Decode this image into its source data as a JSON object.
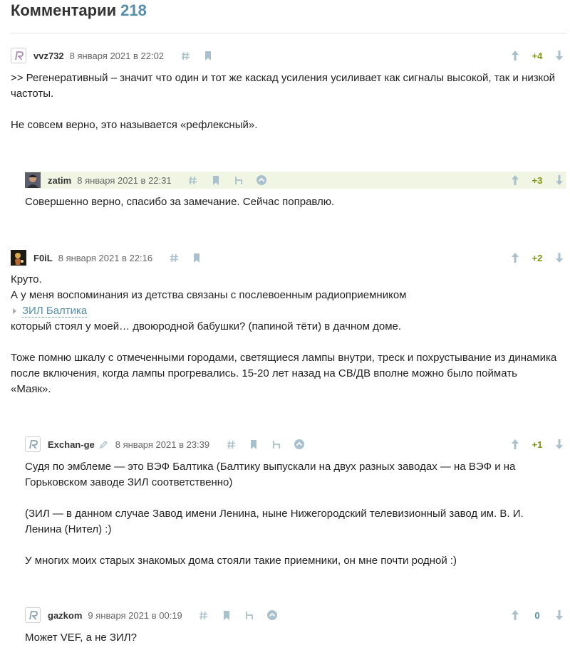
{
  "header": {
    "title": "Комментарии",
    "count": "218"
  },
  "comments": [
    {
      "user": "vvz732",
      "date": "8 января 2021 в 22:02",
      "score": "+4",
      "lines": [
        ">> Регенеративный – значит что один и тот же каскад усиления усиливает как сигналы высокой, так и низкой",
        "частоты.",
        "Не совсем верно, это называется «рефлексный»."
      ]
    },
    {
      "user": "zatim",
      "date": "8 января 2021 в 22:31",
      "score": "+3",
      "lines": [
        "Совершенно верно, спасибо за замечание. Сейчас поправлю."
      ]
    },
    {
      "user": "F0iL",
      "date": "8 января 2021 в 22:16",
      "score": "+2",
      "spoiler": "ЗИЛ Балтика",
      "lines": [
        "Круто.",
        "А у меня воспоминания из детства связаны с послевоенным радиоприемником",
        "который стоял у моей… двоюродной бабушки? (папиной тёти) в дачном доме.",
        "Тоже помню шкалу с отмеченными городами, светящиеся лампы внутри, треск и похрустывание из динамика",
        "после включения, когда лампы прогревались. 15-20 лет назад на СВ/ДВ вполне можно было поймать",
        "«Маяк»."
      ]
    },
    {
      "user": "Exchan-ge",
      "date": "8 января 2021 в 23:39",
      "score": "+1",
      "lines": [
        "Судя по эмблеме — это ВЭФ Балтика (Балтику выпускали на двух разных заводах — на ВЭФ и на",
        "Горьковском заводе ЗИЛ соответственно)",
        "(ЗИЛ — в данном случае Завод имени Ленина, ныне Нижегородский телевизионный завод им. В. И.",
        "Ленина (Нител) :)",
        "У многих моих старых знакомых дома стояли такие приемники, он мне почти родной :)"
      ]
    },
    {
      "user": "gazkom",
      "date": "9 января 2021 в 00:19",
      "score": "0",
      "lines": [
        "Может VEF, а не ЗИЛ?"
      ]
    }
  ],
  "colors": {
    "accent": "#548eaa",
    "positive": "#7a9910",
    "highlight": "#f0f6e3",
    "icon": "#a9c1cc"
  }
}
